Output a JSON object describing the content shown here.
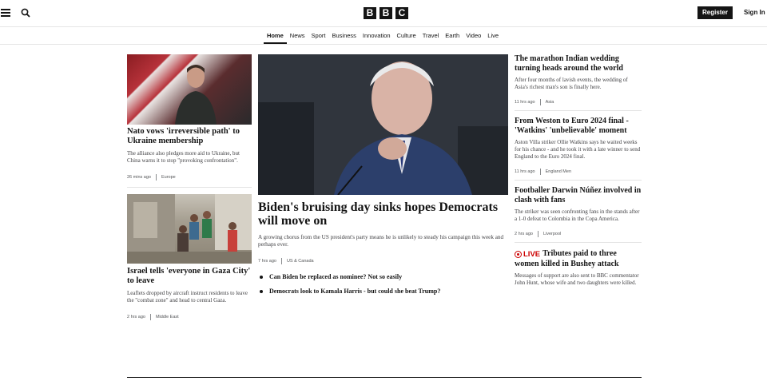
{
  "header": {
    "logo_letters": [
      "B",
      "B",
      "C"
    ],
    "register_label": "Register",
    "signin_label": "Sign In"
  },
  "nav": {
    "items": [
      "Home",
      "News",
      "Sport",
      "Business",
      "Innovation",
      "Culture",
      "Travel",
      "Earth",
      "Video",
      "Live"
    ],
    "active": "Home"
  },
  "left": [
    {
      "headline": "Nato vows 'irreversible path' to Ukraine membership",
      "summary": "The alliance also pledges more aid to Ukraine, but China warns it to stop \"provoking confrontation\".",
      "time": "26 mins ago",
      "section": "Europe"
    },
    {
      "headline": "Israel tells 'everyone in Gaza City' to leave",
      "summary": "Leaflets dropped by aircraft instruct residents to leave the \"combat zone\" and head to central Gaza.",
      "time": "2 hrs ago",
      "section": "Middle East"
    }
  ],
  "main": {
    "headline": "Biden's bruising day sinks hopes Democrats will move on",
    "summary": "A growing chorus from the US president's party means he is unlikely to steady his campaign this week and perhaps ever.",
    "time": "7 hrs ago",
    "section": "US & Canada",
    "related": [
      "Can Biden be replaced as nominee? Not so easily",
      "Democrats look to Kamala Harris - but could she beat Trump?"
    ]
  },
  "right": [
    {
      "headline": "The marathon Indian wedding turning heads around the world",
      "summary": "After four months of lavish events, the wedding of Asia's richest man's son is finally here.",
      "time": "11 hrs ago",
      "section": "Asia"
    },
    {
      "headline": "From Weston to Euro 2024 final - 'Watkins' 'unbelievable' moment",
      "summary": "Aston Villa striker Ollie Watkins says he waited weeks for his chance - and he took it with a late winner to send England to the Euro 2024 final.",
      "time": "11 hrs ago",
      "section": "England Men"
    },
    {
      "headline": "Footballer Darwin Núñez involved in clash with fans",
      "summary": "The striker was seen confronting fans in the stands after a 1-0 defeat to Colombia in the Copa America.",
      "time": "2 hrs ago",
      "section": "Liverpool"
    },
    {
      "live_label": "LIVE",
      "headline": "Tributes paid to three women killed in Bushey attack",
      "summary": "Messages of support are also sent to BBC commentator John Hunt, whose wife and two daughters were killed."
    }
  ],
  "colors": {
    "text": "#141414",
    "live_red": "#cc0000",
    "meta_grey": "#545658"
  }
}
